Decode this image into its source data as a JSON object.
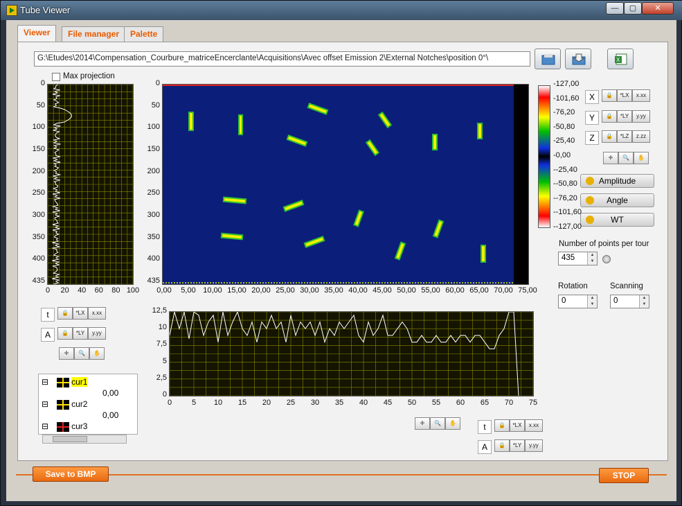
{
  "window": {
    "title": "Tube Viewer"
  },
  "tabs": [
    {
      "label": "Viewer",
      "active": true
    },
    {
      "label": "File manager",
      "active": false
    },
    {
      "label": "Palette",
      "active": false
    }
  ],
  "path": {
    "value": "G:\\Etudes\\2014\\Compensation_Courbure_matriceEncerclante\\Acquisitions\\Avec offset Emission 2\\External Notches\\position 0°\\"
  },
  "max_projection": {
    "label": "Max projection",
    "checked": false
  },
  "side_plot": {
    "y_ticks": [
      "0",
      "50",
      "100",
      "150",
      "200",
      "250",
      "300",
      "350",
      "400",
      "435"
    ],
    "x_ticks": [
      "0",
      "20",
      "40",
      "60",
      "80",
      "100"
    ]
  },
  "main_plot": {
    "y_ticks": [
      "0",
      "50",
      "100",
      "150",
      "200",
      "250",
      "300",
      "350",
      "400",
      "435"
    ],
    "x_ticks": [
      "0,00",
      "5,00",
      "10,00",
      "15,00",
      "20,00",
      "25,00",
      "30,00",
      "35,00",
      "40,00",
      "45,00",
      "50,00",
      "55,00",
      "60,00",
      "65,00",
      "70,00",
      "75,00"
    ]
  },
  "color_scale": {
    "labels": [
      "-127,00",
      "-101,60",
      "-76,20",
      "-50,80",
      "-25,40",
      "-0,00",
      "--25,40",
      "--50,80",
      "--76,20",
      "--101,60",
      "--127,00"
    ]
  },
  "axes_controls": {
    "x": "X",
    "y": "Y",
    "z": "Z",
    "x_fmt": "x.xx",
    "y_fmt": "y.yy",
    "z_fmt": "z.zz"
  },
  "buttons": {
    "amplitude": "Amplitude",
    "angle": "Angle",
    "wt": "WT",
    "save_bmp": "Save to BMP",
    "stop": "STOP"
  },
  "points_per_tour": {
    "label": "Number of points per tour",
    "value": "435"
  },
  "rotation": {
    "label": "Rotation",
    "value": "0"
  },
  "scanning": {
    "label": "Scanning",
    "value": "0"
  },
  "bottom_plot": {
    "y_ticks": [
      "12,5",
      "10",
      "7,5",
      "5",
      "2,5",
      "0"
    ],
    "x_ticks": [
      "0",
      "5",
      "10",
      "15",
      "20",
      "25",
      "30",
      "35",
      "40",
      "45",
      "50",
      "55",
      "60",
      "65",
      "70",
      "75"
    ]
  },
  "left_controls": {
    "t": "t",
    "a": "A",
    "x_fmt": "x.xx",
    "y_fmt": "y.yy"
  },
  "bottom_controls": {
    "t": "t",
    "a": "A",
    "x_fmt": "x.xx",
    "y_fmt": "y.yy"
  },
  "cursors": [
    {
      "name": "cur1",
      "value": "0,00"
    },
    {
      "name": "cur2",
      "value": "0,00"
    },
    {
      "name": "cur3"
    }
  ],
  "chart_data": {
    "type": "line",
    "x": [
      0,
      1,
      2,
      3,
      4,
      5,
      6,
      7,
      8,
      9,
      10,
      11,
      12,
      13,
      14,
      15,
      16,
      17,
      18,
      19,
      20,
      21,
      22,
      23,
      24,
      25,
      26,
      27,
      28,
      29,
      30,
      31,
      32,
      33,
      34,
      35,
      36,
      37,
      38,
      39,
      40,
      41,
      42,
      43,
      44,
      45,
      46,
      47,
      48,
      49,
      50,
      51,
      52,
      53,
      54,
      55,
      56,
      57,
      58,
      59,
      60,
      61,
      62,
      63,
      64,
      65,
      66,
      67,
      68,
      69,
      70,
      71,
      72
    ],
    "values": [
      9,
      12.5,
      10,
      12.5,
      8.5,
      12.5,
      12,
      9,
      11,
      12,
      8,
      12.5,
      9,
      11,
      12.5,
      10,
      9,
      11,
      8,
      11,
      10,
      12,
      10,
      11,
      8,
      12,
      9,
      11,
      10,
      11,
      9,
      11,
      8,
      10,
      9,
      11,
      10,
      11,
      12,
      9,
      8,
      11,
      9,
      10,
      12,
      9,
      9,
      10,
      11,
      10,
      8,
      8,
      9,
      8,
      8,
      9,
      8,
      8,
      9,
      8,
      9,
      9,
      8,
      9,
      9,
      8,
      7,
      7,
      9,
      10,
      12.5,
      12.5,
      0
    ],
    "xlim": [
      0,
      75
    ],
    "ylim": [
      0,
      12.5
    ]
  }
}
